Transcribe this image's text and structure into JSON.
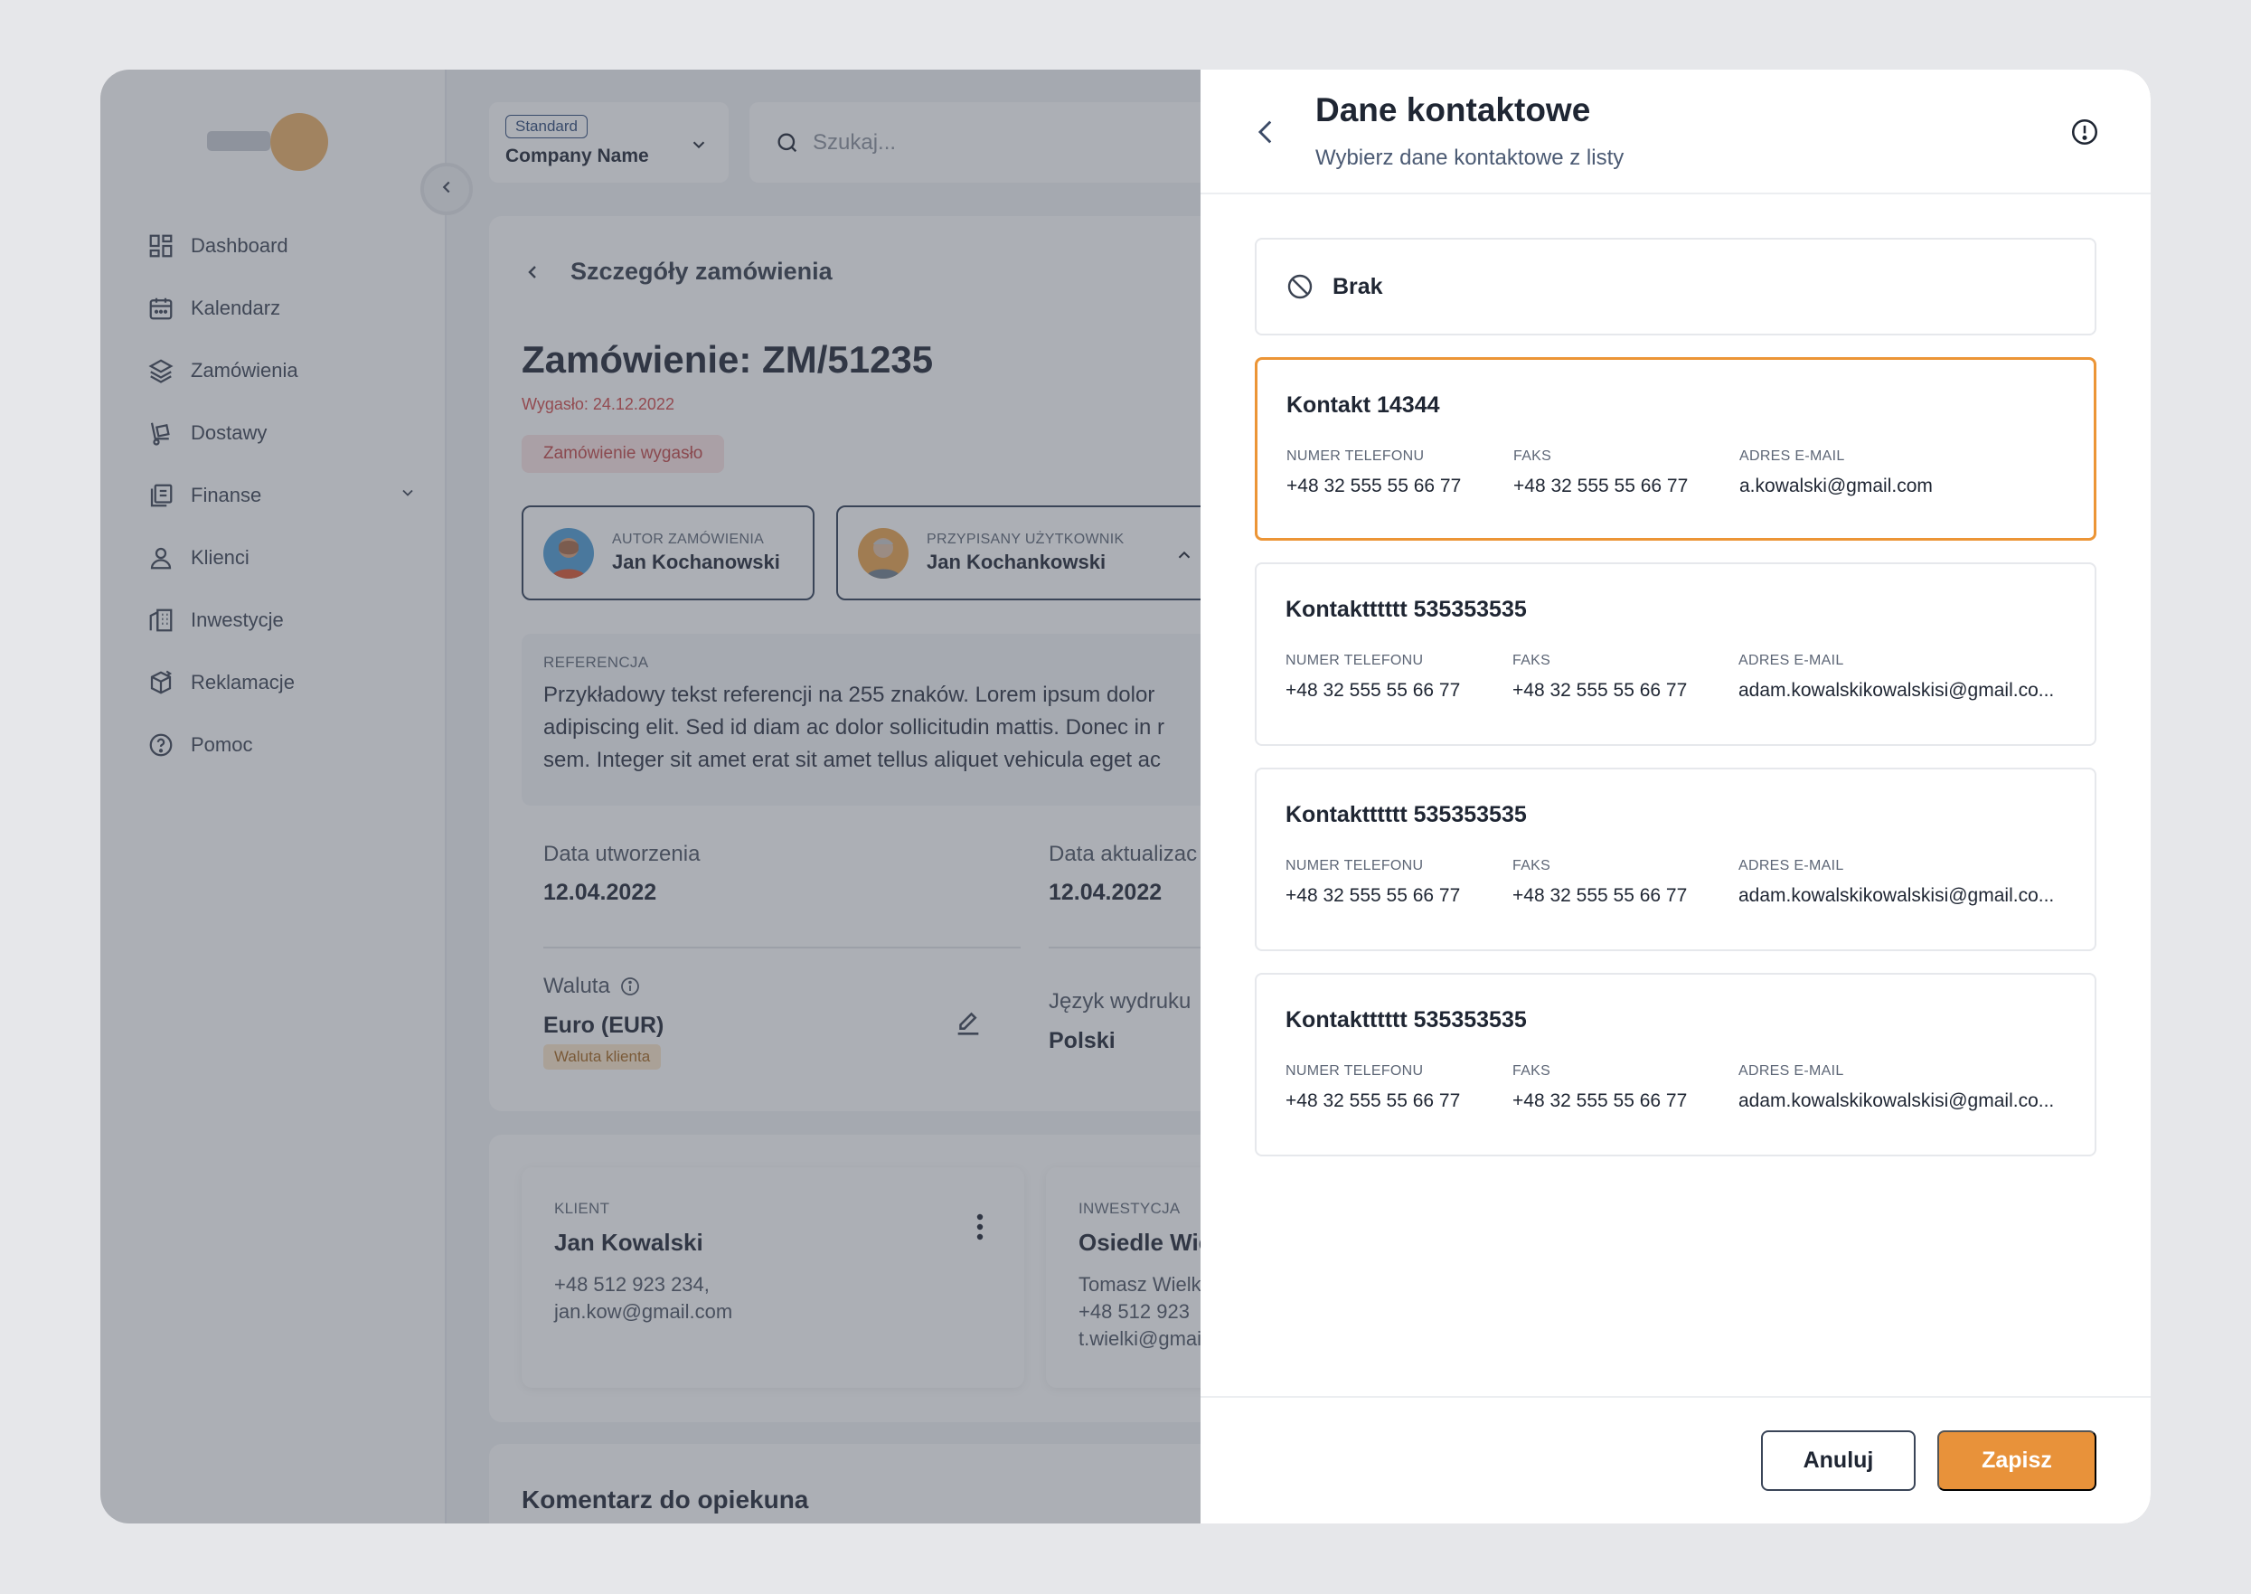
{
  "sidebar": {
    "items": [
      {
        "label": "Dashboard",
        "icon": "dashboard-icon"
      },
      {
        "label": "Kalendarz",
        "icon": "calendar-icon"
      },
      {
        "label": "Zamówienia",
        "icon": "layers-icon"
      },
      {
        "label": "Dostawy",
        "icon": "delivery-icon"
      },
      {
        "label": "Finanse",
        "icon": "finance-icon"
      },
      {
        "label": "Klienci",
        "icon": "user-icon"
      },
      {
        "label": "Inwestycje",
        "icon": "building-icon"
      },
      {
        "label": "Reklamacje",
        "icon": "package-return-icon"
      },
      {
        "label": "Pomoc",
        "icon": "help-icon"
      }
    ]
  },
  "header": {
    "company_badge": "Standard",
    "company_name": "Company Name",
    "search_placeholder": "Szukaj..."
  },
  "order": {
    "breadcrumb": "Szczegóły zamówienia",
    "title": "Zamówienie: ZM/51235",
    "expired_text": "Wygasło: 24.12.2022",
    "status_badge": "Zamówienie wygasło",
    "author_label": "AUTOR ZAMÓWIENIA",
    "author_name": "Jan Kochanowski",
    "assigned_label": "PRZYPISANY UŻYTKOWNIK",
    "assigned_name": "Jan Kochankowski",
    "reference_label": "REFERENCJA",
    "reference_lines": [
      "Przykładowy tekst referencji na 255 znaków. Lorem ipsum dolor",
      "adipiscing elit. Sed id diam ac dolor sollicitudin mattis. Donec in r",
      "sem. Integer sit amet erat sit amet tellus aliquet vehicula eget ac"
    ],
    "created_label": "Data utworzenia",
    "created_value": "12.04.2022",
    "updated_label": "Data aktualizac",
    "updated_value": "12.04.2022",
    "currency_label": "Waluta",
    "currency_value": "Euro (EUR)",
    "currency_tag": "Waluta klienta",
    "language_label": "Język wydruku",
    "language_value": "Polski"
  },
  "client": {
    "label": "KLIENT",
    "name": "Jan Kowalski",
    "phone": "+48 512 923 234,",
    "email": "jan.kow@gmail.com"
  },
  "investment": {
    "label": "INWESTYCJA",
    "name": "Osiedle Wię",
    "person": "Tomasz Wielk",
    "phone": "+48 512 923",
    "email": "t.wielki@gmai"
  },
  "comment": {
    "title": "Komentarz do opiekuna"
  },
  "drawer": {
    "title": "Dane kontaktowe",
    "subtitle": "Wybierz dane kontaktowe z listy",
    "none_option": "Brak",
    "col_phone": "NUMER TELEFONU",
    "col_fax": "FAKS",
    "col_email": "ADRES E-MAIL",
    "contacts": [
      {
        "name": "Kontakt 14344",
        "phone": "+48 32 555 55 66 77",
        "fax": "+48 32 555 55 66 77",
        "email": "a.kowalski@gmail.com",
        "selected": true
      },
      {
        "name": "Kontaktttttt 535353535",
        "phone": "+48 32 555 55 66 77",
        "fax": "+48 32 555 55 66 77",
        "email": "adam.kowalskikowalskisi@gmail.co...",
        "selected": false
      },
      {
        "name": "Kontaktttttt 535353535",
        "phone": "+48 32 555 55 66 77",
        "fax": "+48 32 555 55 66 77",
        "email": "adam.kowalskikowalskisi@gmail.co...",
        "selected": false
      },
      {
        "name": "Kontaktttttt 535353535",
        "phone": "+48 32 555 55 66 77",
        "fax": "+48 32 555 55 66 77",
        "email": "adam.kowalskikowalskisi@gmail.co...",
        "selected": false
      }
    ],
    "cancel_label": "Anuluj",
    "save_label": "Zapisz"
  },
  "colors": {
    "accent": "#e8923a",
    "selected_border": "#ec9536",
    "danger": "#d24a4a"
  }
}
